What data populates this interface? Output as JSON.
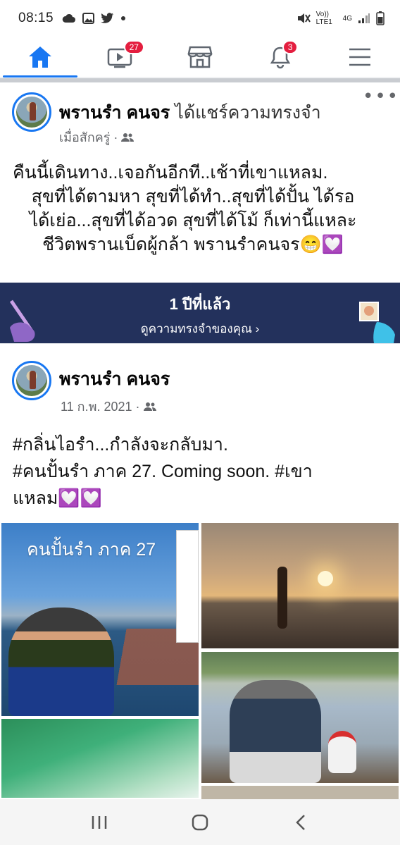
{
  "status_bar": {
    "time": "08:15",
    "volte_label": "Vo)) LTE1",
    "network_label": "4G",
    "notification_icons": [
      "cloud-icon",
      "image-icon",
      "twitter-icon",
      "dot-icon"
    ],
    "right_icons": [
      "mute-icon",
      "signal-icon",
      "battery-icon"
    ]
  },
  "nav": {
    "items": [
      {
        "name": "home",
        "icon": "home-icon",
        "active": true,
        "badge": ""
      },
      {
        "name": "watch",
        "icon": "video-icon",
        "active": false,
        "badge": "27"
      },
      {
        "name": "marketplace",
        "icon": "store-icon",
        "active": false,
        "badge": ""
      },
      {
        "name": "notifications",
        "icon": "bell-icon",
        "active": false,
        "badge": "3"
      },
      {
        "name": "menu",
        "icon": "hamburger-icon",
        "active": false,
        "badge": ""
      }
    ],
    "accent": "#1877f2",
    "badge_color": "#e41e3f"
  },
  "post": {
    "author": "พรานรำ คนจร",
    "action": "ได้แชร์ความทรงจำ",
    "time": "เมื่อสักครู่ ·",
    "audience_icon": "friends-icon",
    "text_lines": [
      "คืนนี้เดินทาง..เจอกันอีกที..เช้าที่เขาแหลม.",
      "สุขที่ได้ตามหา สุขที่ได้ทำ..สุขที่ได้ปั้น ได้รอ",
      "ได้เย่อ...สุขที่ได้อวด สุขที่ได้โม้ ก็เท่านี้แหละ",
      "ชีวิตพรานเบ็ดผู้กล้า พรานรำคนจร😁💟"
    ]
  },
  "memory": {
    "title": "1 ปีที่แล้ว",
    "link": "ดูความทรงจำของคุณ",
    "bg_color": "#23315c"
  },
  "shared_post": {
    "author": "พรานรำ คนจร",
    "time": "11 ก.พ. 2021 ·",
    "audience_icon": "friends-icon",
    "text_lines": [
      "#กลิ่นไอรำ...กำลังจะกลับมา.",
      " #คนปั้นรำ ภาค 27.   Coming soon.  #เขา",
      "แหลม💟💟"
    ],
    "photo_caption": "คนปั้นรำ ภาค 27"
  },
  "bottom_nav": {
    "items": [
      "recent-apps-icon",
      "home-circle-icon",
      "back-icon"
    ]
  }
}
